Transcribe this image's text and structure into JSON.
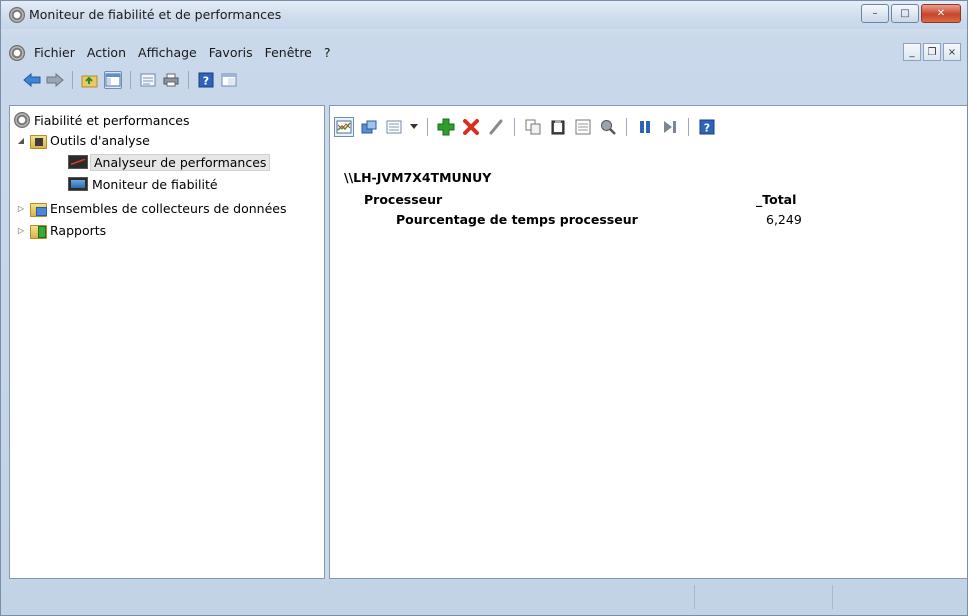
{
  "window": {
    "title": "Moniteur de fiabilité et de performances",
    "buttons": {
      "minimize": "–",
      "maximize": "□",
      "close": "✕"
    }
  },
  "menu": {
    "items": [
      "Fichier",
      "Action",
      "Affichage",
      "Favoris",
      "Fenêtre",
      "?"
    ],
    "mdi": {
      "minimize": "_",
      "restore": "❐",
      "close": "×"
    }
  },
  "toolbar": {
    "icons": [
      "back-icon",
      "forward-icon",
      "up-icon",
      "show-hide-tree-icon",
      "properties-icon",
      "print-icon",
      "help-icon",
      "console-icon"
    ]
  },
  "tree": {
    "root": "Fiabilité et performances",
    "outils": "Outils d'analyse",
    "analyseur": "Analyseur de performances",
    "moniteur": "Moniteur de fiabilité",
    "ensembles": "Ensembles de collecteurs de données",
    "rapports": "Rapports"
  },
  "report": {
    "host": "\\\\LH-JVM7X4TMUNUY",
    "object": "Processeur",
    "instance": "_Total",
    "counter": "Pourcentage de temps processeur",
    "value": "6,249"
  },
  "colors": {
    "frame": "#c9d8ea",
    "accent_blue": "#2a6bb0",
    "add_green": "#2f9e2f",
    "delete_red": "#d83020"
  }
}
